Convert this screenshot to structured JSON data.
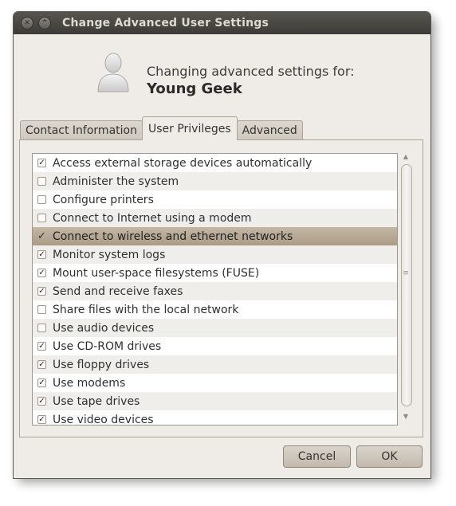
{
  "window": {
    "title": "Change Advanced User Settings"
  },
  "header": {
    "line1": "Changing advanced settings for:",
    "user": "Young Geek",
    "avatar_icon": "user-silhouette-icon"
  },
  "tabs": [
    {
      "label": "Contact Information",
      "active": false
    },
    {
      "label": "User Privileges",
      "active": true
    },
    {
      "label": "Advanced",
      "active": false
    }
  ],
  "privileges": [
    {
      "label": "Access external storage devices automatically",
      "checked": true
    },
    {
      "label": "Administer the system",
      "checked": false
    },
    {
      "label": "Configure printers",
      "checked": false
    },
    {
      "label": "Connect to Internet using a modem",
      "checked": false
    },
    {
      "label": "Connect to wireless and ethernet networks",
      "checked": true,
      "selected": true
    },
    {
      "label": "Monitor system logs",
      "checked": true
    },
    {
      "label": "Mount user-space filesystems (FUSE)",
      "checked": true
    },
    {
      "label": "Send and receive faxes",
      "checked": true
    },
    {
      "label": "Share files with the local network",
      "checked": false
    },
    {
      "label": "Use audio devices",
      "checked": false
    },
    {
      "label": "Use CD-ROM drives",
      "checked": true
    },
    {
      "label": "Use floppy drives",
      "checked": true
    },
    {
      "label": "Use modems",
      "checked": true
    },
    {
      "label": "Use tape drives",
      "checked": true
    },
    {
      "label": "Use video devices",
      "checked": true
    }
  ],
  "buttons": {
    "cancel": "Cancel",
    "ok": "OK"
  },
  "colors": {
    "window_bg": "#efebe7",
    "selection": "#b3a48f",
    "titlebar": "#4a4844"
  }
}
